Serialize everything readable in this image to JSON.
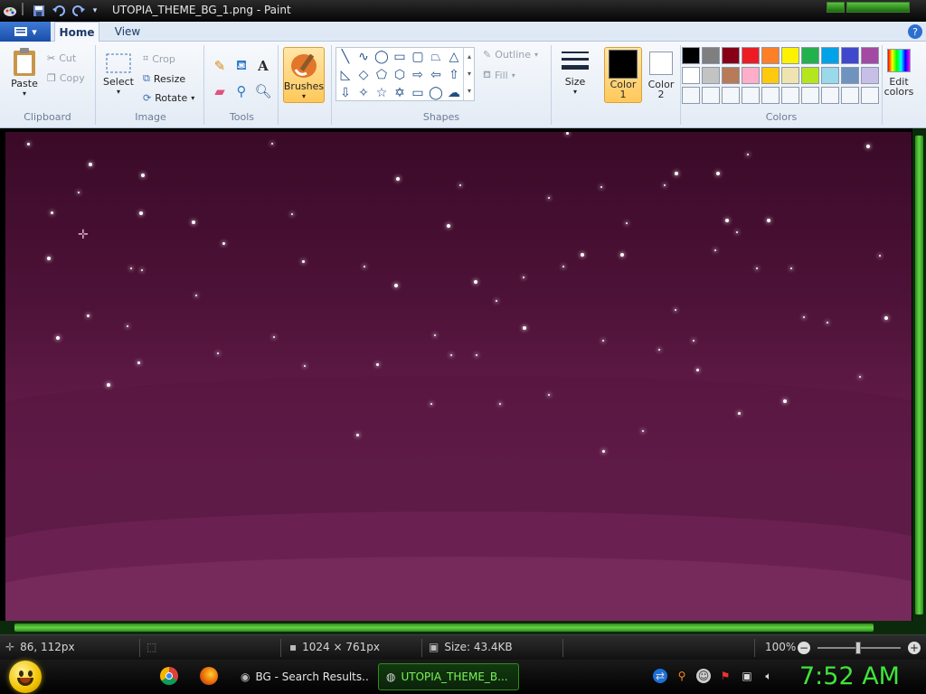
{
  "window": {
    "title": "UTOPIA_THEME_BG_1.png - Paint",
    "file_menu_icon": "paint-file-menu-icon"
  },
  "tabs": [
    {
      "label": "Home",
      "active": true
    },
    {
      "label": "View",
      "active": false
    }
  ],
  "ribbon": {
    "clipboard": {
      "label": "Clipboard",
      "paste": "Paste",
      "cut": "Cut",
      "copy": "Copy"
    },
    "image": {
      "label": "Image",
      "select": "Select",
      "crop": "Crop",
      "resize": "Resize",
      "rotate": "Rotate"
    },
    "tools": {
      "label": "Tools"
    },
    "brushes": "Brushes",
    "shapes": {
      "label": "Shapes",
      "outline": "Outline",
      "fill": "Fill"
    },
    "size": "Size",
    "color1": {
      "label": "Color\n1",
      "line1": "Color",
      "line2": "1",
      "value": "#000000"
    },
    "color2": {
      "label": "Color\n2",
      "line1": "Color",
      "line2": "2",
      "value": "#ffffff"
    },
    "colors": {
      "label": "Colors",
      "palette_row1": [
        "#000000",
        "#7f7f7f",
        "#880015",
        "#ed1c24",
        "#ff7f27",
        "#fff200",
        "#22b14c",
        "#00a2e8",
        "#3f48cc",
        "#a349a4"
      ],
      "palette_row2": [
        "#ffffff",
        "#c3c3c3",
        "#b97a57",
        "#ffaec9",
        "#ffc90e",
        "#efe4b0",
        "#b5e61d",
        "#99d9ea",
        "#7092be",
        "#c8bfe7"
      ]
    },
    "edit_colors": {
      "line1": "Edit",
      "line2": "colors"
    }
  },
  "status": {
    "cursor_pos": "86, 112px",
    "dimensions": "1024 × 761px",
    "size": "Size: 43.4KB",
    "zoom": "100%"
  },
  "taskbar": {
    "tasks": [
      {
        "label": "BG - Search Results...",
        "active": false
      },
      {
        "label": "UTOPIA_THEME_B...",
        "active": true
      }
    ],
    "clock": "7:52 AM"
  }
}
